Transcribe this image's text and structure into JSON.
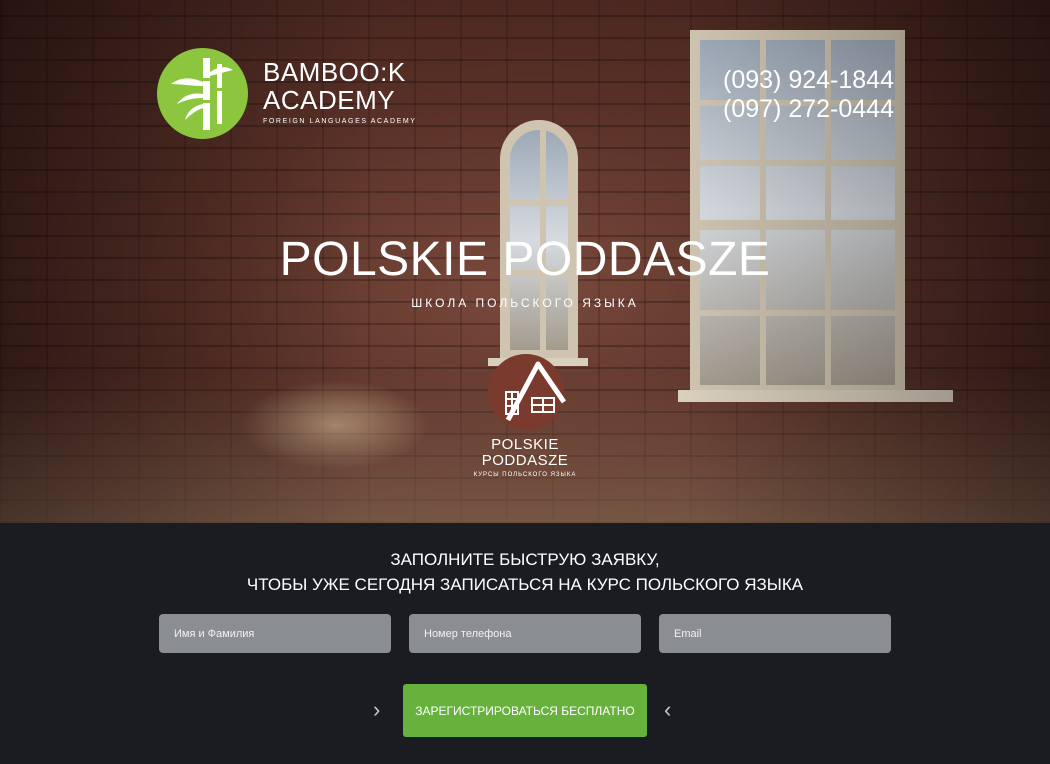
{
  "brand": {
    "line1": "BAMBOO:K",
    "line2": "ACADEMY",
    "tagline": "FOREIGN LANGUAGES ACADEMY",
    "accent": "#8cc63f"
  },
  "contacts": {
    "phone1": "(093) 924-1844",
    "phone2": "(097) 272-0444"
  },
  "hero": {
    "title": "POLSKIE PODDASZE",
    "subtitle": "ШКОЛА ПОЛЬСКОГО ЯЗЫКА",
    "emblem_line1": "POLSKIE",
    "emblem_line2": "PODDASZE",
    "emblem_tag": "КУРСЫ ПОЛЬСКОГО ЯЗЫКА",
    "emblem_color": "#7a3a2e"
  },
  "form": {
    "heading_line1": "ЗАПОЛНИТЕ БЫСТРУЮ ЗАЯВКУ,",
    "heading_line2": "ЧТОБЫ УЖЕ СЕГОДНЯ ЗАПИСАТЬСЯ НА КУРС ПОЛЬСКОГО ЯЗЫКА",
    "name_placeholder": "Имя и Фамилия",
    "phone_placeholder": "Номер телефона",
    "email_placeholder": "Email",
    "submit_label": "ЗАРЕГИСТРИРОВАТЬСЯ БЕСПЛАТНО",
    "submit_color": "#67b23c",
    "arrow_left_icon": "chevron-right-icon",
    "arrow_right_icon": "chevron-left-icon"
  }
}
